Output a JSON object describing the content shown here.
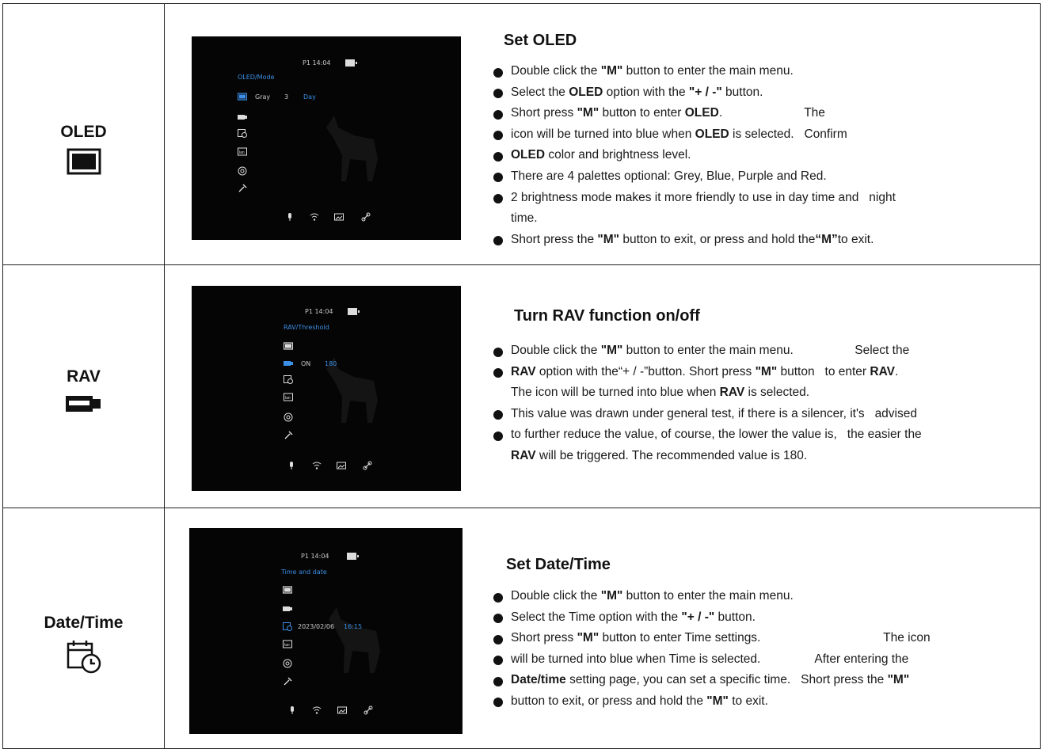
{
  "rows": [
    {
      "label": "OLED",
      "icon": "oled-icon",
      "title": "Set OLED",
      "bullets": [
        [
          {
            "t": "Double click the "
          },
          {
            "t": "\"M\"",
            "b": true
          },
          {
            "t": " button to enter the main menu."
          }
        ],
        [
          {
            "t": "Select the "
          },
          {
            "t": "OLED",
            "b": true
          },
          {
            "t": " option with the "
          },
          {
            "t": "\"+ / -\"",
            "b": true
          },
          {
            "t": " button."
          }
        ],
        [
          {
            "t": "Short press "
          },
          {
            "t": "\"M\"",
            "b": true
          },
          {
            "t": " button to enter "
          },
          {
            "t": "OLED",
            "b": true
          },
          {
            "t": ".                        The"
          }
        ],
        [
          {
            "t": "icon will be turned into blue when "
          },
          {
            "t": "OLED",
            "b": true
          },
          {
            "t": " is selected.   Confirm"
          }
        ],
        [
          {
            "t": "OLED",
            "b": true
          },
          {
            "t": " color and brightness level."
          }
        ],
        [
          {
            "t": "There are 4 palettes optional: Grey, Blue, Purple and Red."
          }
        ],
        [
          {
            "t": "2 brightness mode makes it more friendly to use in day time and   night"
          }
        ],
        [
          {
            "t": "time.",
            "cont": true
          }
        ],
        [
          {
            "t": "Short press the "
          },
          {
            "t": "\"M\"",
            "b": true
          },
          {
            "t": " button to exit, or press and hold the"
          },
          {
            "t": "“M”",
            "b": true
          },
          {
            "t": "to exit."
          }
        ]
      ],
      "screen": {
        "status": "P1   14:04",
        "menu_path": "OLED/Mode",
        "row_value": "Gray",
        "row_level": "3",
        "row_mode": "Day"
      }
    },
    {
      "label": "RAV",
      "icon": "rav-icon",
      "title": "Turn RAV function on/off",
      "bullets": [
        [
          {
            "t": "Double click the "
          },
          {
            "t": "\"M\"",
            "b": true
          },
          {
            "t": " button to enter the main menu.                  Select the"
          }
        ],
        [
          {
            "t": "RAV",
            "b": true
          },
          {
            "t": " option with the“+ / -”button. Short press "
          },
          {
            "t": "\"M\"",
            "b": true
          },
          {
            "t": " button   to enter "
          },
          {
            "t": "RAV",
            "b": true
          },
          {
            "t": "."
          }
        ],
        [
          {
            "t": "The icon will be turned into blue when ",
            "cont": true
          },
          {
            "t": "RAV",
            "b": true
          },
          {
            "t": " is selected."
          }
        ],
        [
          {
            "t": "This value was drawn under general test, if there is a silencer, it's   advised"
          }
        ],
        [
          {
            "t": "to further reduce the value, of course, the lower the value is,   the easier the"
          }
        ],
        [
          {
            "t": "RAV",
            "b": true,
            "cont": true
          },
          {
            "t": " will be triggered. The recommended value is 180."
          }
        ]
      ],
      "screen": {
        "status": "P1   14:04",
        "menu_path": "RAV/Threshold",
        "row_value": "ON",
        "row_level": "180"
      }
    },
    {
      "label": "Date/Time",
      "icon": "calendar-clock-icon",
      "title": "Set Date/Time",
      "bullets": [
        [
          {
            "t": "Double click the "
          },
          {
            "t": "\"M\"",
            "b": true
          },
          {
            "t": " button to enter the main menu."
          }
        ],
        [
          {
            "t": "Select the Time option with the "
          },
          {
            "t": "\"+ / -\"",
            "b": true
          },
          {
            "t": " button."
          }
        ],
        [
          {
            "t": "Short press "
          },
          {
            "t": "\"M\"",
            "b": true
          },
          {
            "t": " button to enter Time settings.                                    The icon"
          }
        ],
        [
          {
            "t": "will be turned into blue when Time is selected.                After entering the"
          }
        ],
        [
          {
            "t": "Date/time",
            "b": true
          },
          {
            "t": " setting page, you can set a specific time.   Short press the "
          },
          {
            "t": "\"M\"",
            "b": true
          }
        ],
        [
          {
            "t": "button to exit, or press and hold the "
          },
          {
            "t": "\"M\"",
            "b": true
          },
          {
            "t": " to exit."
          }
        ]
      ],
      "screen": {
        "status": "P1   14:04",
        "menu_path": "Time and date",
        "row_value": "2023/02/06",
        "row_level": "16:15"
      }
    }
  ]
}
